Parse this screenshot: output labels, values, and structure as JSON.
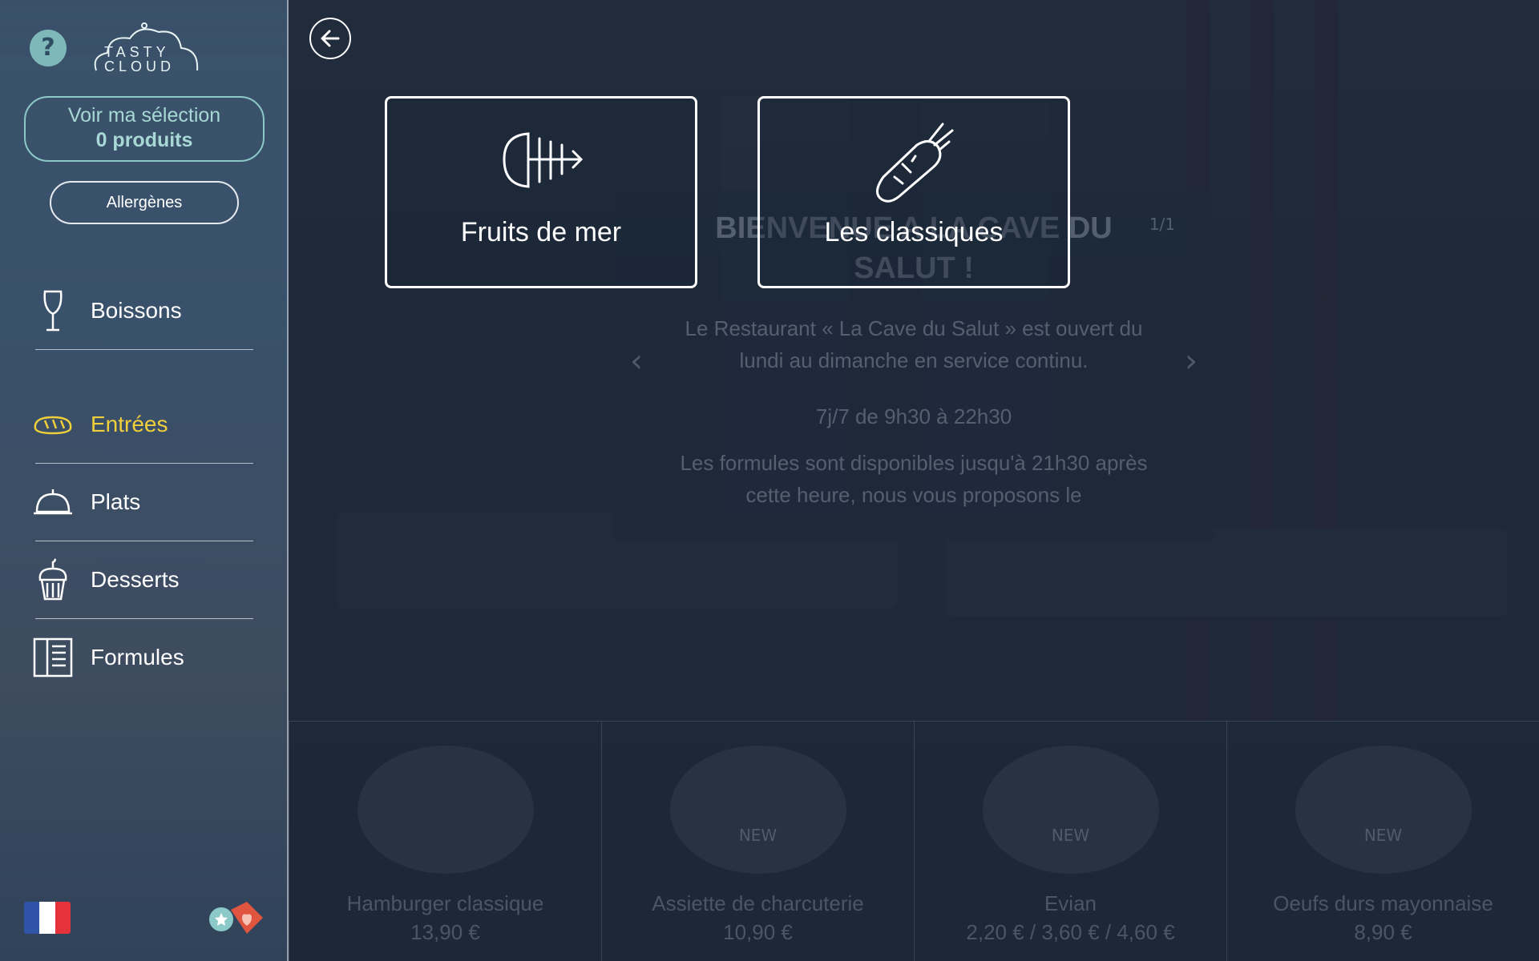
{
  "sidebar": {
    "help_icon_glyph": "?",
    "logo_text": "TASTY CLOUD",
    "selection": {
      "line1": "Voir ma sélection",
      "line2": "0 produits"
    },
    "allergens_label": "Allergènes",
    "items": [
      {
        "label": "Boissons",
        "icon": "wine-glass-icon",
        "active": false
      },
      {
        "label": "Entrées",
        "icon": "bread-icon",
        "active": true
      },
      {
        "label": "Plats",
        "icon": "cloche-icon",
        "active": false
      },
      {
        "label": "Desserts",
        "icon": "cupcake-icon",
        "active": false
      },
      {
        "label": "Formules",
        "icon": "menu-book-icon",
        "active": false
      }
    ],
    "language": "fr",
    "accent_color": "#f0cf3a"
  },
  "categories": [
    {
      "label": "Fruits de mer",
      "icon": "fish-bone-icon"
    },
    {
      "label": "Les classiques",
      "icon": "carrot-icon"
    }
  ],
  "welcome": {
    "title": "BIENVENUE A LA CAVE DU SALUT !",
    "pager": "1/1",
    "paragraph1": "Le Restaurant « La Cave du Salut » est ouvert du lundi au dimanche en service continu.",
    "paragraph2": "7j/7 de 9h30 à 22h30",
    "paragraph3": "Les formules sont disponibles jusqu'à 21h30 après cette heure, nous vous proposons le"
  },
  "products": [
    {
      "name": "Hamburger classique",
      "price": "13,90 €",
      "badge": ""
    },
    {
      "name": "Assiette de charcuterie",
      "price": "10,90 €",
      "badge": "NEW"
    },
    {
      "name": "Evian",
      "price": "2,20 € / 3,60 € / 4,60 €",
      "badge": "NEW"
    },
    {
      "name": "Oeufs durs mayonnaise",
      "price": "8,90 €",
      "badge": "NEW"
    }
  ]
}
